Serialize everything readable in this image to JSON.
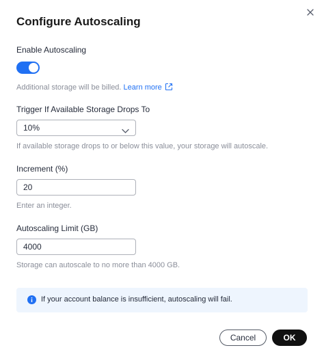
{
  "dialog": {
    "title": "Configure Autoscaling"
  },
  "enable": {
    "label": "Enable Autoscaling",
    "toggle_on": true
  },
  "billing": {
    "note": "Additional storage will be billed.",
    "learn_more": "Learn more"
  },
  "trigger": {
    "label": "Trigger If Available Storage Drops To",
    "selected": "10%",
    "hint": "If available storage drops to or below this value, your storage will autoscale."
  },
  "increment": {
    "label": "Increment (%)",
    "value": "20",
    "hint": "Enter an integer."
  },
  "limit": {
    "label": "Autoscaling Limit (GB)",
    "value": "4000",
    "hint": "Storage can autoscale to no more than 4000 GB."
  },
  "alert": {
    "text": "If your account balance is insufficient, autoscaling will fail."
  },
  "buttons": {
    "cancel": "Cancel",
    "ok": "OK"
  },
  "colors": {
    "accent": "#2070f3",
    "alert_bg": "#eef5fe",
    "primary_button": "#111111"
  }
}
